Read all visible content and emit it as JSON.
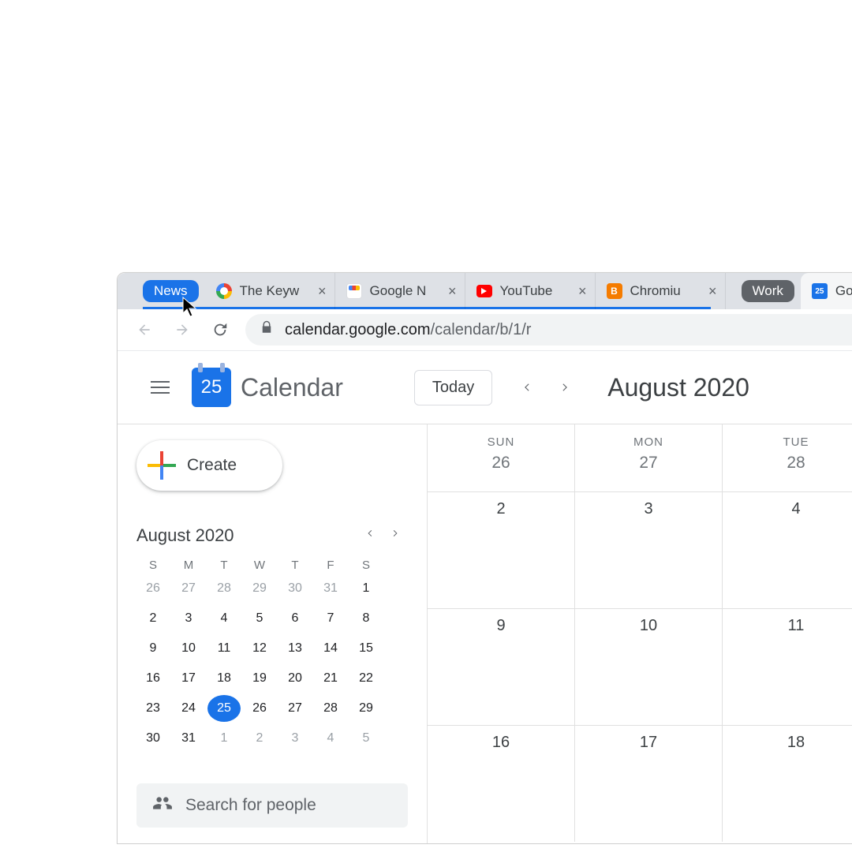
{
  "browser": {
    "groups": [
      {
        "name": "News",
        "color": "#1a73e8"
      },
      {
        "name": "Work",
        "color": "#5f6368"
      }
    ],
    "tabs": [
      {
        "title": "The Keyw",
        "favicon": "google-icon",
        "group": 0
      },
      {
        "title": "Google N",
        "favicon": "google-news-icon",
        "group": 0
      },
      {
        "title": "YouTube",
        "favicon": "youtube-icon",
        "group": 0
      },
      {
        "title": "Chromiu",
        "favicon": "blogger-icon",
        "group": 0
      },
      {
        "title": "Goo",
        "favicon": "calendar-icon",
        "group": 1,
        "active": true
      }
    ],
    "url_host": "calendar.google.com",
    "url_path": "/calendar/b/1/r"
  },
  "app": {
    "name": "Calendar",
    "logo_day": "25",
    "today_label": "Today",
    "view_month": "August 2020"
  },
  "sidebar": {
    "create_label": "Create",
    "mini_title": "August 2020",
    "mini_dow": [
      "S",
      "M",
      "T",
      "W",
      "T",
      "F",
      "S"
    ],
    "mini_weeks": [
      [
        {
          "d": 26,
          "m": true
        },
        {
          "d": 27,
          "m": true
        },
        {
          "d": 28,
          "m": true
        },
        {
          "d": 29,
          "m": true
        },
        {
          "d": 30,
          "m": true
        },
        {
          "d": 31,
          "m": true
        },
        {
          "d": 1
        }
      ],
      [
        {
          "d": 2
        },
        {
          "d": 3
        },
        {
          "d": 4
        },
        {
          "d": 5
        },
        {
          "d": 6
        },
        {
          "d": 7
        },
        {
          "d": 8
        }
      ],
      [
        {
          "d": 9
        },
        {
          "d": 10
        },
        {
          "d": 11
        },
        {
          "d": 12
        },
        {
          "d": 13
        },
        {
          "d": 14
        },
        {
          "d": 15
        }
      ],
      [
        {
          "d": 16
        },
        {
          "d": 17
        },
        {
          "d": 18
        },
        {
          "d": 19
        },
        {
          "d": 20
        },
        {
          "d": 21
        },
        {
          "d": 22
        }
      ],
      [
        {
          "d": 23
        },
        {
          "d": 24
        },
        {
          "d": 25,
          "today": true
        },
        {
          "d": 26
        },
        {
          "d": 27
        },
        {
          "d": 28
        },
        {
          "d": 29
        }
      ],
      [
        {
          "d": 30
        },
        {
          "d": 31
        },
        {
          "d": 1,
          "m": true
        },
        {
          "d": 2,
          "m": true
        },
        {
          "d": 3,
          "m": true
        },
        {
          "d": 4,
          "m": true
        },
        {
          "d": 5,
          "m": true
        }
      ]
    ],
    "search_placeholder": "Search for people"
  },
  "grid": {
    "dow": [
      "SUN",
      "MON",
      "TUE"
    ],
    "header_dates": [
      26,
      27,
      28
    ],
    "rows": [
      [
        2,
        3,
        4
      ],
      [
        9,
        10,
        11
      ],
      [
        16,
        17,
        18
      ]
    ]
  }
}
